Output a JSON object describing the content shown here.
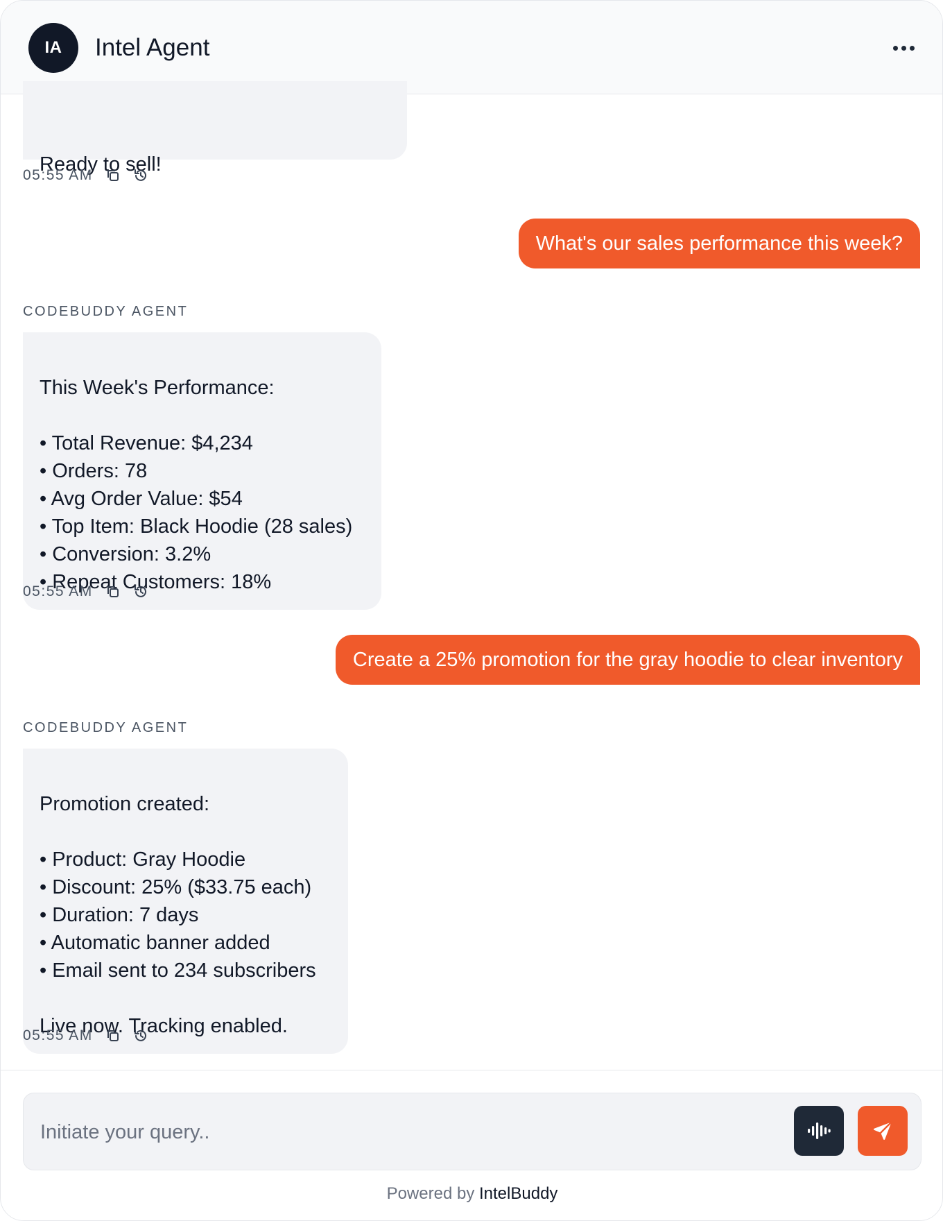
{
  "header": {
    "avatar_initials": "IA",
    "title": "Intel Agent",
    "menu_icon": "more-horizontal-icon"
  },
  "messages": [
    {
      "role": "agent",
      "text": "Ready to sell!",
      "time": "05:55 AM"
    },
    {
      "role": "user",
      "text": "What's our sales performance this week?"
    },
    {
      "role": "agent",
      "sender": "CODEBUDDY AGENT",
      "text": "This Week's Performance:\n\n• Total Revenue: $4,234\n• Orders: 78\n• Avg Order Value: $54\n• Top Item: Black Hoodie (28 sales)\n• Conversion: 3.2%\n• Repeat Customers: 18%",
      "time": "05:55 AM"
    },
    {
      "role": "user",
      "text": "Create a 25% promotion for the gray hoodie to clear inventory"
    },
    {
      "role": "agent",
      "sender": "CODEBUDDY AGENT",
      "text": "Promotion created:\n\n• Product: Gray Hoodie\n• Discount: 25% ($33.75 each)\n• Duration: 7 days\n• Automatic banner added\n• Email sent to 234 subscribers\n\nLive now. Tracking enabled.",
      "time": "05:55 AM"
    }
  ],
  "composer": {
    "placeholder": "Initiate your query..",
    "voice_icon": "audio-waveform-icon",
    "send_icon": "send-icon"
  },
  "footer": {
    "powered_prefix": "Powered by",
    "brand": "IntelBuddy"
  },
  "colors": {
    "accent": "#f05a2b",
    "dark": "#111827",
    "agent_bubble": "#f2f3f6"
  }
}
